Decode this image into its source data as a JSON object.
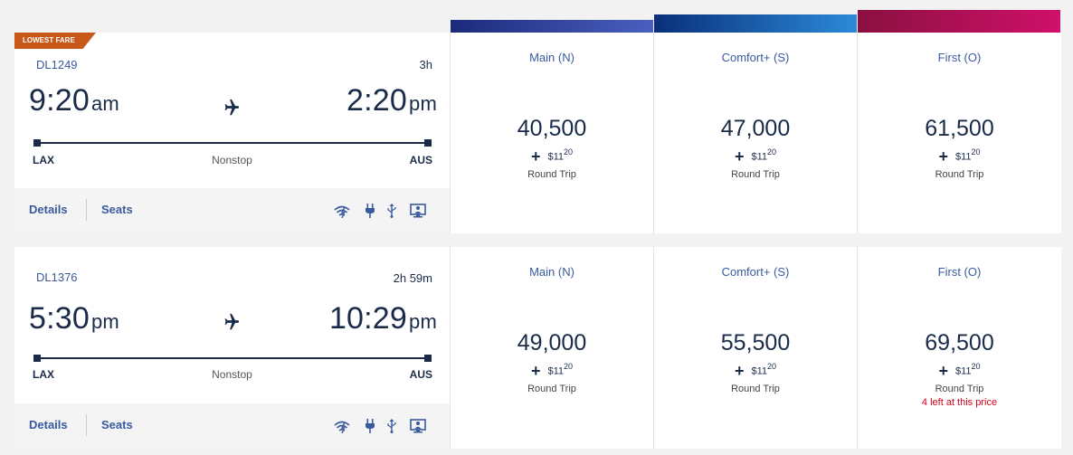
{
  "badge": {
    "label": "LOWEST FARE"
  },
  "flights": [
    {
      "flight_number": "DL1249",
      "duration": "3h",
      "depart_time": "9:20",
      "depart_ampm": "am",
      "arrive_time": "2:20",
      "arrive_ampm": "pm",
      "origin": "LAX",
      "destination": "AUS",
      "stops": "Nonstop",
      "details_label": "Details",
      "seats_label": "Seats",
      "fares": [
        {
          "cabin": "Main (N)",
          "miles": "40,500",
          "tax_dollars": "$11",
          "tax_cents": "20",
          "trip": "Round Trip",
          "availability": ""
        },
        {
          "cabin": "Comfort+ (S)",
          "miles": "47,000",
          "tax_dollars": "$11",
          "tax_cents": "20",
          "trip": "Round Trip",
          "availability": ""
        },
        {
          "cabin": "First (O)",
          "miles": "61,500",
          "tax_dollars": "$11",
          "tax_cents": "20",
          "trip": "Round Trip",
          "availability": ""
        }
      ]
    },
    {
      "flight_number": "DL1376",
      "duration": "2h 59m",
      "depart_time": "5:30",
      "depart_ampm": "pm",
      "arrive_time": "10:29",
      "arrive_ampm": "pm",
      "origin": "LAX",
      "destination": "AUS",
      "stops": "Nonstop",
      "details_label": "Details",
      "seats_label": "Seats",
      "fares": [
        {
          "cabin": "Main (N)",
          "miles": "49,000",
          "tax_dollars": "$11",
          "tax_cents": "20",
          "trip": "Round Trip",
          "availability": ""
        },
        {
          "cabin": "Comfort+ (S)",
          "miles": "55,500",
          "tax_dollars": "$11",
          "tax_cents": "20",
          "trip": "Round Trip",
          "availability": ""
        },
        {
          "cabin": "First (O)",
          "miles": "69,500",
          "tax_dollars": "$11",
          "tax_cents": "20",
          "trip": "Round Trip",
          "availability": "4 left at this price"
        }
      ]
    }
  ],
  "amenity_icons": [
    "wifi-icon",
    "power-outlet-icon",
    "usb-icon",
    "entertainment-screen-icon"
  ],
  "colors": {
    "navy": "#1a2b49",
    "link_blue": "#3a5a9e",
    "badge_orange": "#c8581a",
    "alert_red": "#d0021b",
    "main_tab": [
      "#1b2a7a",
      "#4a5fc0"
    ],
    "comfort_tab": [
      "#0b2f7a",
      "#2a8ad8"
    ],
    "first_tab": [
      "#8a1040",
      "#d0106a"
    ]
  }
}
